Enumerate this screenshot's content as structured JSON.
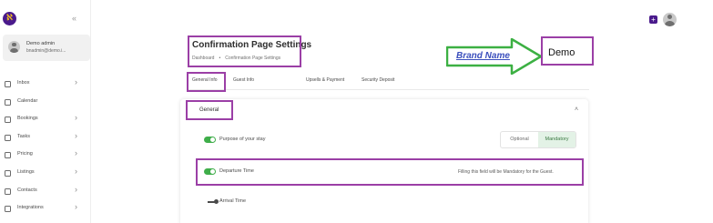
{
  "sidebar": {
    "logo_glyph": "ℵ",
    "collapse_icon": "«",
    "user": {
      "name": "Demo admin",
      "email": "bnadmin@demo.i..."
    },
    "items": [
      {
        "label": "Inbox",
        "icon": "inbox-icon",
        "chevron": "›"
      },
      {
        "label": "Calendar",
        "icon": "calendar-icon",
        "chevron": ""
      },
      {
        "label": "Bookings",
        "icon": "bookings-icon",
        "chevron": "›"
      },
      {
        "label": "Tasks",
        "icon": "tasks-icon",
        "chevron": "›"
      },
      {
        "label": "Pricing",
        "icon": "pricing-icon",
        "chevron": "›"
      },
      {
        "label": "Listings",
        "icon": "listings-icon",
        "chevron": "›"
      },
      {
        "label": "Contacts",
        "icon": "contacts-icon",
        "chevron": "›"
      },
      {
        "label": "Integrations",
        "icon": "integrations-icon",
        "chevron": "›"
      }
    ]
  },
  "topbar": {
    "action_icon": "+",
    "avatar_icon": "user-avatar-icon"
  },
  "header": {
    "title": "Confirmation Page Settings",
    "breadcrumb": {
      "home": "Dashboard",
      "separator": "•",
      "current": "Confirmation Page Settings"
    }
  },
  "annotation": {
    "brand_label": "Brand Name",
    "demo_text": "Demo",
    "arrow_color": "#3cb043",
    "highlight_color": "#9b3fa6"
  },
  "tabs": [
    "General Info",
    "Guest Info",
    "Upsells & Payment",
    "Security Deposit"
  ],
  "general": {
    "title": "General",
    "caret": "˄",
    "fields": {
      "purpose": {
        "label": "Purpose of your stay",
        "enabled": true,
        "options": [
          "Optional",
          "Mandatory"
        ],
        "selected": "Mandatory"
      },
      "departure": {
        "label": "Departure Time",
        "enabled": true,
        "note": "Filling this field will be Mandatory for the Guest."
      },
      "arrival": {
        "label": "Arrival Time",
        "enabled": false
      }
    }
  },
  "colors": {
    "brand": "#4a1a8c",
    "toggle_on": "#3fae4a",
    "mandatory_bg": "#e3f2e6"
  }
}
